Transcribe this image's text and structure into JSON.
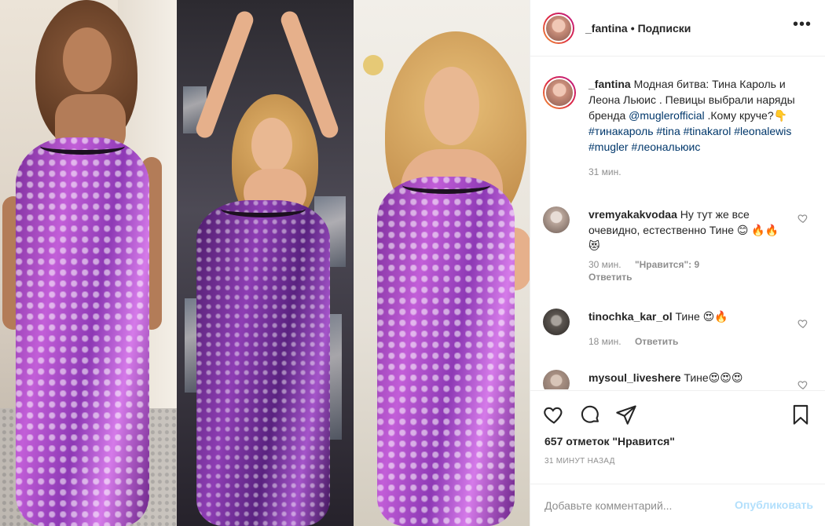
{
  "header": {
    "username": "_fantina",
    "separator": "•",
    "follow_label": "Подписки",
    "more_icon": "more-horizontal-icon"
  },
  "caption": {
    "username": "_fantina",
    "text_1": "Модная битва: Тина Кароль и Леона Льюис . Певицы выбрали наряды бренда",
    "mention": "@muglerofficial",
    "text_2": ".Кому круче?👇",
    "hashtags": [
      "#тинакароль",
      "#tina",
      "#tinakarol",
      "#leonalewis",
      "#mugler",
      "#леональюис"
    ],
    "time": "31 мин."
  },
  "comments": [
    {
      "username": "vremyakakvodaa",
      "text": "Ну тут же все очевидно, естественно Тине 😊 🔥🔥😻",
      "time": "30 мин.",
      "likes": "\"Нравится\": 9",
      "reply": "Ответить"
    },
    {
      "username": "tinochka_kar_ol",
      "text": "Тине 😍🔥",
      "time": "18 мин.",
      "reply": "Ответить"
    },
    {
      "username": "mysoul_liveshere",
      "text": "Тине😍😍😍"
    }
  ],
  "actions": {
    "like_icon": "heart-icon",
    "comment_icon": "comment-icon",
    "share_icon": "share-icon",
    "save_icon": "bookmark-icon",
    "likes_text": "657 отметок \"Нравится\"",
    "posted_ago": "31 минут назад"
  },
  "add_comment": {
    "placeholder": "Добавьте комментарий...",
    "publish_label": "Опубликовать"
  },
  "colors": {
    "link": "#00376b",
    "muted": "#8e8e8e",
    "text": "#262626",
    "publish_disabled": "#b2dffc",
    "border": "#efefef"
  }
}
